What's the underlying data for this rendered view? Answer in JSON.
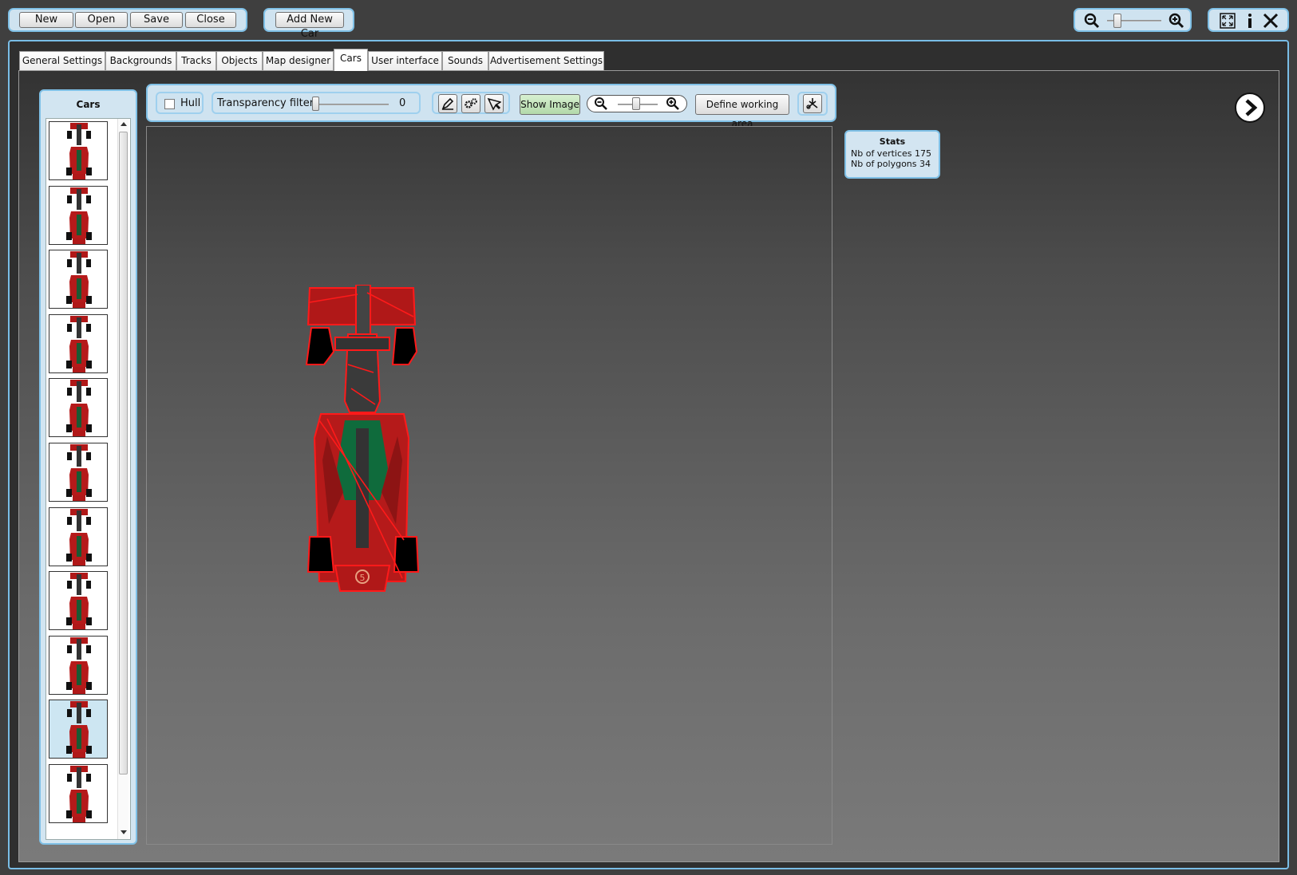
{
  "top_toolbar": {
    "new_label": "New",
    "open_label": "Open",
    "save_label": "Save",
    "close_label": "Close",
    "add_car_label": "Add New Car"
  },
  "tabs": [
    {
      "label": "General Settings"
    },
    {
      "label": "Backgrounds"
    },
    {
      "label": "Tracks"
    },
    {
      "label": "Objects"
    },
    {
      "label": "Map designer"
    },
    {
      "label": "Cars",
      "active": true
    },
    {
      "label": "User interface"
    },
    {
      "label": "Sounds"
    },
    {
      "label": "Advertisement Settings"
    }
  ],
  "cars_panel": {
    "title": "Cars",
    "thumbnail_count": 11,
    "selected_index": 9
  },
  "editor_toolbar": {
    "hull_label": "Hull",
    "hull_checked": false,
    "transparency_label": "Transparency filter",
    "transparency_value": "0",
    "show_image_label": "Show Image",
    "define_area_label": "Define working area"
  },
  "stats": {
    "title": "Stats",
    "vertices_label": "Nb of vertices",
    "vertices_value": "175",
    "polygons_label": "Nb of polygons",
    "polygons_value": "34"
  },
  "colors": {
    "accent": "#7fc0e6",
    "panel": "#cfe3f0",
    "car_red": "#b01818",
    "outline": "#ff1a1a"
  }
}
